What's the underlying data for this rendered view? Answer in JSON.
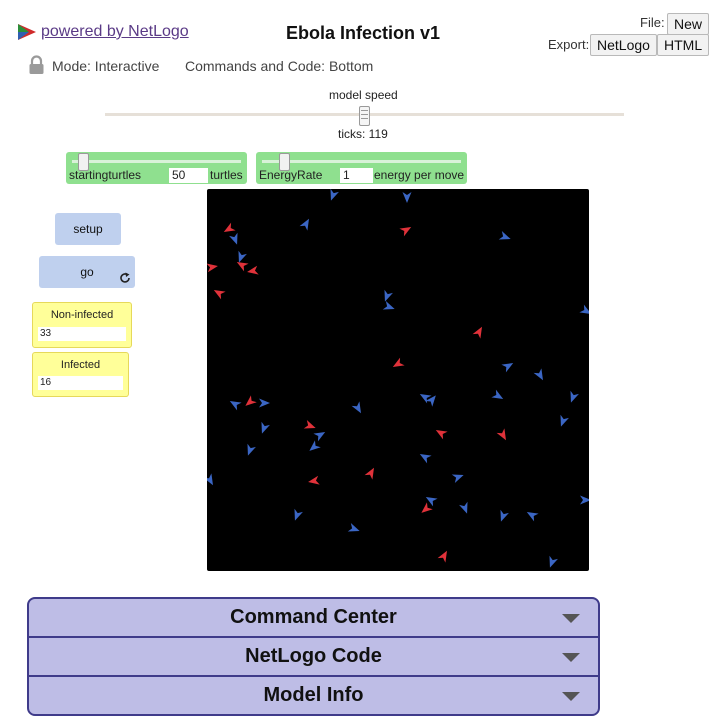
{
  "header": {
    "powered_by": "powered by NetLogo",
    "title": "Ebola Infection v1",
    "file_label": "File:",
    "new_button": "New",
    "export_label": "Export:",
    "export_netlogo": "NetLogo",
    "export_html": "HTML"
  },
  "mode": {
    "mode_text": "Mode: Interactive",
    "commands_text": "Commands and Code: Bottom"
  },
  "speed": {
    "label": "model speed",
    "ticks_text": "ticks: 119"
  },
  "sliders": [
    {
      "label": "startingturtles",
      "value": "50",
      "units": "turtles"
    },
    {
      "label": "EnergyRate",
      "value": "1",
      "units": "energy per move"
    }
  ],
  "buttons": {
    "setup": "setup",
    "go": "go"
  },
  "monitors": [
    {
      "label": "Non-infected",
      "value": "33"
    },
    {
      "label": "Infected",
      "value": "16"
    }
  ],
  "panels": {
    "command_center": "Command Center",
    "netlogo_code": "NetLogo Code",
    "model_info": "Model Info"
  },
  "colors": {
    "healthy_turtle": "#3b66c4",
    "infected_turtle": "#e0323a",
    "slider_green": "#8fe08f",
    "monitor_yellow": "#ffff99",
    "button_blue": "#bfd0ee",
    "panel_purple": "#bebde6"
  }
}
